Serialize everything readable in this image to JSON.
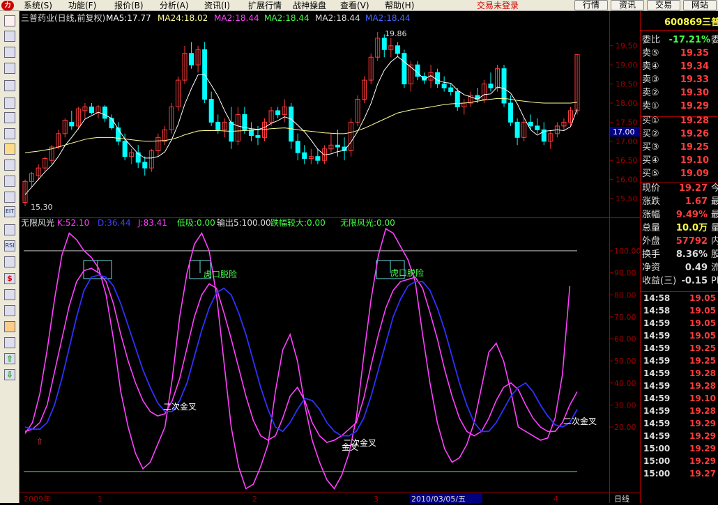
{
  "menu": {
    "items": [
      "系统(S)",
      "功能(F)",
      "报价(B)",
      "分析(A)",
      "资讯(I)",
      "扩展行情",
      "战神操盘",
      "查看(V)",
      "帮助(H)"
    ],
    "trade_status": "交易未登录",
    "buttons": [
      "行情",
      "资讯",
      "交易",
      "网站"
    ]
  },
  "toolbar": {
    "icons": [
      "logo-icon",
      "grid-icon",
      "list-icon",
      "line-chart-icon",
      "candle-icon",
      "table-icon",
      "table-alt-icon",
      "doc-icon",
      "folder-icon",
      "people-icon",
      "globe-icon",
      "search-icon",
      "exit-icon",
      "sync-icon",
      "rsi-icon",
      "calendar-icon",
      "dollar-icon",
      "link-icon",
      "import-icon",
      "pencil-icon",
      "move-icon",
      "arrow-up-icon",
      "arrow-down-icon"
    ],
    "labels": {
      "rsi": "RSI",
      "exit": "EIT"
    }
  },
  "main_chart": {
    "title": "三普药业(日线,前复权)",
    "ma5_label": "MA5:17.77",
    "ma24_label": "MA24:18.02",
    "ma_extra": [
      "MA2:18.44",
      "MA2:18.44",
      "MA2:18.44",
      "MA2:18.44"
    ],
    "ma_extra_colors": [
      "#ff44ff",
      "#44ff44",
      "#dddddd",
      "#4466ff"
    ],
    "high_label": "19.86",
    "low_label": "15.30",
    "price_ticks": [
      "19.50",
      "19.00",
      "18.50",
      "18.00",
      "17.50",
      "17.00",
      "16.50",
      "16.00",
      "15.50"
    ],
    "current_price": "17.00"
  },
  "indicator": {
    "name": "无限风光",
    "k_label": "K:52.10",
    "d_label": "D:36.44",
    "j_label": "J:83.41",
    "low_label": "低吸:0.00",
    "output_label": "输出5:100.00",
    "drop_label": "跌幅较大:0.00",
    "wxfg_label": "无限风光:0.00",
    "ticks": [
      "100.00",
      "90.00",
      "80.00",
      "70.00",
      "60.00",
      "50.00",
      "40.00",
      "30.00",
      "20.00"
    ],
    "annotations": {
      "golden_cross": "二次金叉",
      "escape": "虎口脱险",
      "cross": "金叉"
    }
  },
  "date_axis": {
    "labels": [
      "2009年",
      "1",
      "2",
      "3",
      "2010/03/05/五",
      "4"
    ],
    "period": "日线"
  },
  "quote": {
    "code": "600869",
    "name": "三普",
    "weibi_label": "委比",
    "weibi_value": "-17.21%",
    "weibi_tail": "委",
    "asks": [
      {
        "label": "卖⑤",
        "price": "19.35"
      },
      {
        "label": "卖④",
        "price": "19.34"
      },
      {
        "label": "卖③",
        "price": "19.33"
      },
      {
        "label": "卖②",
        "price": "19.30"
      },
      {
        "label": "卖①",
        "price": "19.29"
      }
    ],
    "bids": [
      {
        "label": "买①",
        "price": "19.28"
      },
      {
        "label": "买②",
        "price": "19.26"
      },
      {
        "label": "买③",
        "price": "19.25"
      },
      {
        "label": "买④",
        "price": "19.10"
      },
      {
        "label": "买⑤",
        "price": "19.09"
      }
    ],
    "stats": [
      {
        "label": "现价",
        "value": "19.27",
        "tail": "今",
        "color": "#ff3c3c"
      },
      {
        "label": "涨跌",
        "value": "1.67",
        "tail": "最",
        "color": "#ff3c3c"
      },
      {
        "label": "涨幅",
        "value": "9.49%",
        "tail": "最",
        "color": "#ff3c3c"
      },
      {
        "label": "总量",
        "value": "10.0万",
        "tail": "量",
        "color": "#ffff44"
      },
      {
        "label": "外盘",
        "value": "57792",
        "tail": "内",
        "color": "#ff3c3c"
      },
      {
        "label": "换手",
        "value": "8.36%",
        "tail": "股",
        "color": "#dddddd"
      },
      {
        "label": "净资",
        "value": "0.49",
        "tail": "流",
        "color": "#dddddd"
      },
      {
        "label": "收益(三)",
        "value": "-0.15",
        "tail": "PE",
        "color": "#dddddd"
      }
    ],
    "ticks": [
      {
        "time": "14:58",
        "price": "19.05"
      },
      {
        "time": "14:58",
        "price": "19.05"
      },
      {
        "time": "14:59",
        "price": "19.05"
      },
      {
        "time": "14:59",
        "price": "19.05"
      },
      {
        "time": "14:59",
        "price": "19.25"
      },
      {
        "time": "14:59",
        "price": "19.25"
      },
      {
        "time": "14:59",
        "price": "19.28"
      },
      {
        "time": "14:59",
        "price": "19.28"
      },
      {
        "time": "14:59",
        "price": "19.10"
      },
      {
        "time": "14:59",
        "price": "19.28"
      },
      {
        "time": "14:59",
        "price": "19.29"
      },
      {
        "time": "14:59",
        "price": "19.29"
      },
      {
        "time": "15:00",
        "price": "19.29"
      },
      {
        "time": "15:00",
        "price": "19.29"
      },
      {
        "time": "15:00",
        "price": "19.27"
      }
    ]
  },
  "colors": {
    "up": "#ff3c3c",
    "down": "#00ffff",
    "k": "#ff40ff",
    "d": "#3030ff",
    "j": "#ff40ff",
    "ma5": "#ffffff",
    "ma24": "#ffff99",
    "axis": "#a00000"
  },
  "chart_data": {
    "type": "line",
    "ohlc": [
      [
        15.4,
        16.0,
        15.3,
        15.95
      ],
      [
        15.95,
        16.2,
        15.8,
        16.15
      ],
      [
        16.1,
        16.4,
        16.0,
        16.3
      ],
      [
        16.3,
        16.6,
        16.2,
        16.55
      ],
      [
        16.5,
        16.9,
        16.4,
        16.85
      ],
      [
        16.85,
        17.3,
        16.8,
        17.2
      ],
      [
        17.2,
        17.6,
        17.1,
        17.55
      ],
      [
        17.5,
        17.8,
        17.3,
        17.4
      ],
      [
        17.4,
        17.9,
        17.3,
        17.85
      ],
      [
        17.8,
        18.0,
        17.6,
        17.9
      ],
      [
        17.9,
        18.0,
        17.7,
        17.75
      ],
      [
        17.75,
        17.95,
        17.6,
        17.9
      ],
      [
        17.9,
        17.95,
        17.5,
        17.6
      ],
      [
        17.6,
        17.7,
        17.3,
        17.35
      ],
      [
        17.35,
        17.5,
        16.9,
        17.0
      ],
      [
        17.0,
        17.2,
        16.5,
        16.6
      ],
      [
        16.6,
        16.8,
        16.4,
        16.7
      ],
      [
        16.7,
        16.9,
        16.3,
        16.45
      ],
      [
        16.45,
        16.6,
        16.1,
        16.3
      ],
      [
        16.3,
        16.8,
        16.2,
        16.75
      ],
      [
        16.75,
        17.2,
        16.6,
        17.1
      ],
      [
        17.0,
        17.4,
        16.9,
        17.3
      ],
      [
        17.3,
        18.0,
        17.2,
        17.9
      ],
      [
        17.9,
        18.7,
        17.8,
        18.6
      ],
      [
        18.6,
        19.5,
        18.5,
        19.3
      ],
      [
        19.3,
        19.6,
        18.9,
        19.0
      ],
      [
        19.0,
        19.5,
        18.8,
        19.4
      ],
      [
        19.4,
        19.6,
        18.0,
        18.1
      ],
      [
        18.1,
        18.3,
        17.4,
        17.5
      ],
      [
        17.5,
        17.7,
        17.2,
        17.3
      ],
      [
        17.3,
        17.6,
        17.1,
        17.5
      ],
      [
        17.5,
        17.9,
        16.8,
        17.0
      ],
      [
        17.0,
        17.9,
        16.9,
        17.7
      ],
      [
        17.7,
        17.9,
        17.2,
        17.3
      ],
      [
        17.3,
        17.5,
        17.0,
        17.15
      ],
      [
        17.15,
        17.4,
        16.9,
        17.1
      ],
      [
        17.1,
        17.6,
        17.0,
        17.5
      ],
      [
        17.5,
        17.9,
        17.4,
        17.8
      ],
      [
        17.8,
        17.9,
        17.6,
        17.7
      ],
      [
        17.7,
        18.1,
        17.5,
        17.9
      ],
      [
        17.9,
        18.0,
        16.8,
        17.0
      ],
      [
        17.0,
        17.2,
        16.5,
        16.7
      ],
      [
        16.7,
        16.9,
        16.4,
        16.55
      ],
      [
        16.55,
        16.8,
        16.4,
        16.6
      ],
      [
        16.6,
        16.8,
        16.4,
        16.5
      ],
      [
        16.5,
        16.9,
        16.4,
        16.8
      ],
      [
        16.8,
        17.2,
        16.7,
        16.9
      ],
      [
        16.9,
        17.3,
        16.6,
        16.85
      ],
      [
        16.85,
        17.1,
        16.5,
        16.75
      ],
      [
        16.75,
        17.6,
        16.6,
        17.5
      ],
      [
        17.5,
        18.2,
        17.4,
        18.1
      ],
      [
        18.1,
        18.7,
        18.0,
        18.6
      ],
      [
        18.6,
        19.3,
        18.5,
        19.2
      ],
      [
        19.2,
        19.86,
        19.1,
        19.7
      ],
      [
        19.7,
        19.8,
        19.2,
        19.4
      ],
      [
        19.4,
        19.7,
        19.2,
        19.5
      ],
      [
        19.5,
        19.6,
        19.2,
        19.3
      ],
      [
        19.3,
        19.4,
        18.4,
        18.5
      ],
      [
        18.5,
        19.1,
        18.3,
        19.0
      ],
      [
        19.0,
        19.1,
        18.6,
        18.7
      ],
      [
        18.7,
        18.8,
        18.5,
        18.6
      ],
      [
        18.6,
        19.0,
        18.4,
        18.8
      ],
      [
        18.8,
        18.9,
        18.4,
        18.5
      ],
      [
        18.5,
        18.7,
        18.3,
        18.4
      ],
      [
        18.4,
        18.5,
        18.2,
        18.3
      ],
      [
        18.3,
        18.4,
        17.8,
        17.9
      ],
      [
        17.9,
        18.1,
        17.7,
        18.0
      ],
      [
        18.0,
        18.3,
        17.9,
        18.2
      ],
      [
        18.2,
        18.4,
        18.0,
        18.1
      ],
      [
        18.1,
        18.6,
        18.0,
        18.5
      ],
      [
        18.5,
        18.8,
        18.3,
        18.4
      ],
      [
        18.4,
        19.0,
        18.3,
        18.9
      ],
      [
        18.9,
        19.0,
        17.9,
        18.0
      ],
      [
        18.0,
        18.2,
        17.4,
        17.5
      ],
      [
        17.5,
        17.6,
        16.9,
        17.1
      ],
      [
        17.1,
        17.6,
        17.0,
        17.5
      ],
      [
        17.5,
        17.7,
        17.3,
        17.4
      ],
      [
        17.4,
        17.6,
        17.2,
        17.3
      ],
      [
        17.3,
        17.5,
        16.9,
        17.0
      ],
      [
        17.0,
        17.3,
        16.8,
        17.2
      ],
      [
        17.2,
        17.5,
        17.1,
        17.4
      ],
      [
        17.4,
        17.6,
        17.3,
        17.5
      ],
      [
        17.5,
        17.9,
        17.4,
        17.8
      ],
      [
        17.8,
        19.27,
        17.7,
        19.27
      ]
    ],
    "ma5": [
      15.6,
      15.8,
      16.0,
      16.2,
      16.37,
      16.6,
      16.89,
      17.1,
      17.33,
      17.58,
      17.67,
      17.76,
      17.69,
      17.6,
      17.32,
      17.06,
      16.86,
      16.67,
      16.56,
      16.56,
      16.6,
      16.72,
      17.03,
      17.44,
      17.97,
      18.38,
      18.74,
      18.74,
      18.47,
      18.18,
      17.8,
      17.47,
      17.4,
      17.36,
      17.33,
      17.31,
      17.36,
      17.47,
      17.54,
      17.64,
      17.58,
      17.42,
      17.25,
      17.03,
      16.79,
      16.64,
      16.67,
      16.73,
      16.76,
      16.98,
      17.26,
      17.6,
      17.99,
      18.5,
      18.86,
      19.08,
      19.22,
      19.08,
      18.94,
      18.8,
      18.62,
      18.72,
      18.6,
      18.54,
      18.52,
      18.34,
      18.22,
      18.16,
      18.1,
      18.22,
      18.24,
      18.42,
      18.38,
      18.26,
      17.98,
      17.62,
      17.3,
      17.16,
      17.26,
      17.28,
      17.3,
      17.28,
      17.38,
      17.85
    ],
    "ma24": [
      16.7,
      16.72,
      16.74,
      16.77,
      16.8,
      16.85,
      16.9,
      16.95,
      17.0,
      17.05,
      17.08,
      17.1,
      17.1,
      17.1,
      17.08,
      17.06,
      17.04,
      17.02,
      17.0,
      17.0,
      17.01,
      17.02,
      17.05,
      17.1,
      17.17,
      17.22,
      17.27,
      17.28,
      17.28,
      17.28,
      17.27,
      17.26,
      17.27,
      17.28,
      17.29,
      17.3,
      17.31,
      17.33,
      17.34,
      17.35,
      17.33,
      17.3,
      17.28,
      17.26,
      17.24,
      17.22,
      17.21,
      17.2,
      17.2,
      17.23,
      17.28,
      17.34,
      17.42,
      17.5,
      17.58,
      17.66,
      17.74,
      17.78,
      17.82,
      17.85,
      17.87,
      17.9,
      17.93,
      17.96,
      17.98,
      17.99,
      18.0,
      18.02,
      18.05,
      18.08,
      18.1,
      18.12,
      18.12,
      18.1,
      18.07,
      18.05,
      18.03,
      18.01,
      18.0,
      18.0,
      18.0,
      18.0,
      18.0,
      18.02
    ],
    "k": [
      18,
      19,
      22,
      30,
      45,
      60,
      75,
      86,
      91,
      92,
      90,
      86,
      76,
      62,
      50,
      40,
      32,
      27,
      25,
      26,
      32,
      42,
      56,
      70,
      80,
      85,
      83,
      72,
      60,
      47,
      34,
      23,
      16,
      14,
      16,
      24,
      34,
      38,
      32,
      22,
      16,
      13,
      14,
      16,
      19,
      22,
      33,
      48,
      62,
      74,
      82,
      86,
      87,
      88,
      83,
      72,
      60,
      46,
      34,
      24,
      18,
      16,
      18,
      24,
      32,
      38,
      40,
      37,
      30,
      24,
      20,
      18,
      18,
      22,
      30,
      36
    ],
    "d": [
      20,
      19,
      19,
      22,
      30,
      42,
      56,
      70,
      82,
      88,
      89,
      88,
      84,
      76,
      66,
      56,
      46,
      38,
      31,
      27,
      27,
      32,
      40,
      52,
      64,
      74,
      81,
      83,
      80,
      72,
      62,
      50,
      38,
      28,
      20,
      18,
      22,
      28,
      33,
      32,
      28,
      22,
      18,
      16,
      16,
      18,
      24,
      34,
      46,
      58,
      70,
      78,
      84,
      86,
      86,
      82,
      74,
      64,
      52,
      40,
      30,
      22,
      18,
      18,
      22,
      28,
      34,
      38,
      40,
      36,
      30,
      25,
      21,
      20,
      22,
      28
    ],
    "j": [
      17,
      22,
      35,
      55,
      78,
      98,
      108,
      105,
      100,
      97,
      92,
      80,
      60,
      36,
      20,
      8,
      1,
      4,
      12,
      20,
      42,
      70,
      90,
      103,
      108,
      100,
      80,
      50,
      20,
      2,
      -8,
      -6,
      2,
      12,
      36,
      55,
      62,
      50,
      30,
      14,
      4,
      -4,
      -8,
      -2,
      8,
      24,
      52,
      78,
      98,
      110,
      108,
      102,
      96,
      86,
      62,
      40,
      22,
      10,
      4,
      6,
      12,
      22,
      38,
      54,
      58,
      50,
      36,
      20,
      18,
      16,
      14,
      15,
      24,
      44,
      84
    ]
  }
}
